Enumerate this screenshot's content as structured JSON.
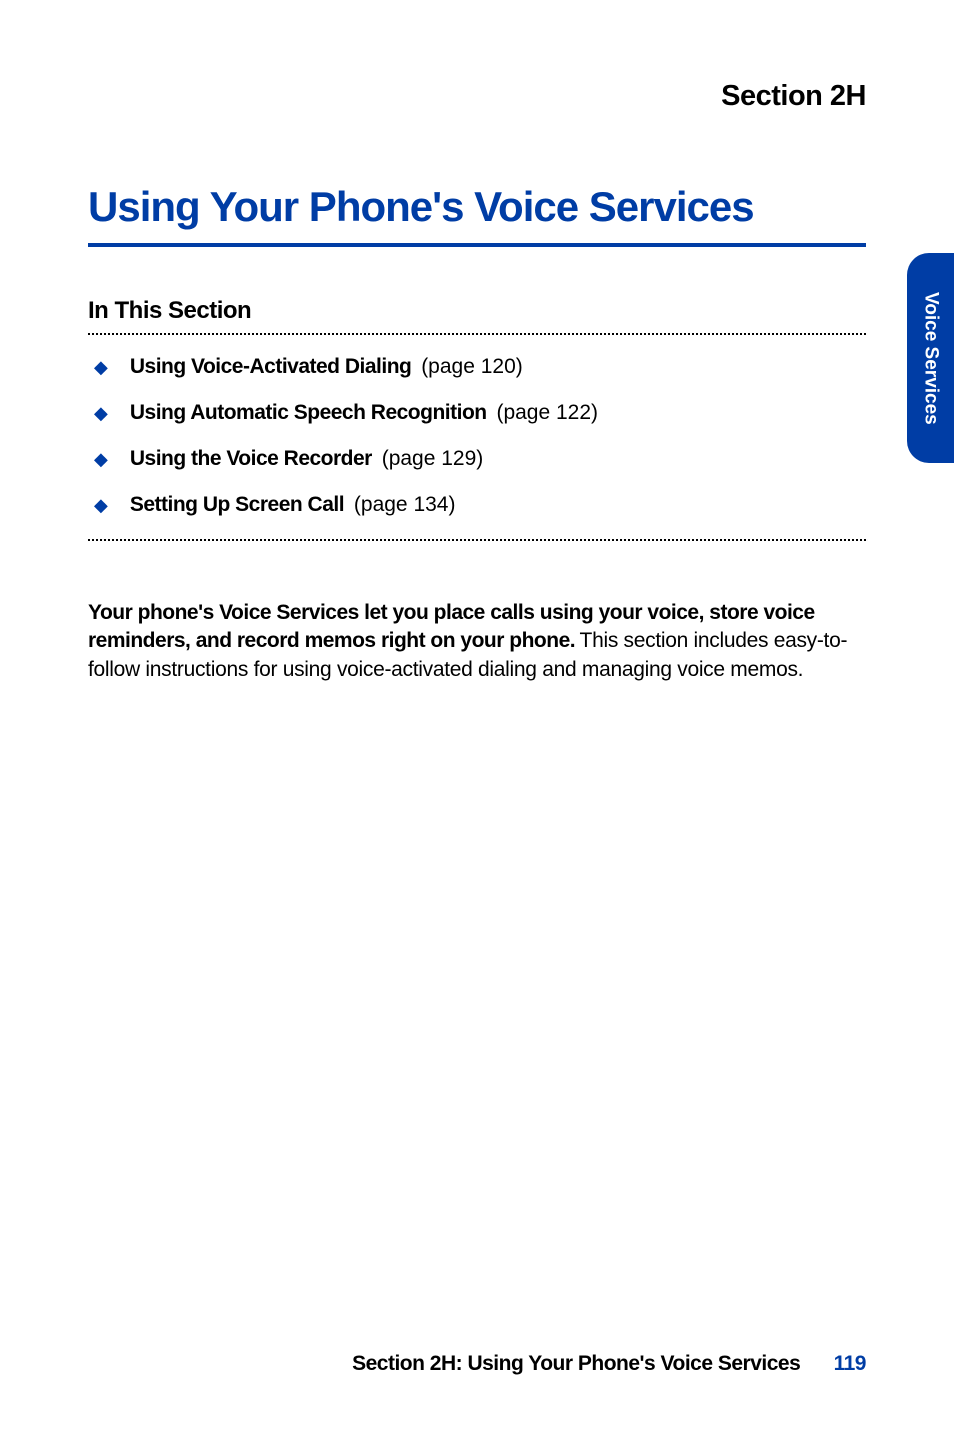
{
  "section_label": "Section 2H",
  "main_title": "Using Your Phone's Voice Services",
  "in_this_section_label": "In This Section",
  "toc": [
    {
      "title": "Using Voice-Activated Dialing",
      "page": "(page 120)"
    },
    {
      "title": "Using Automatic Speech Recognition",
      "page": "(page 122)"
    },
    {
      "title": "Using the Voice Recorder",
      "page": "(page 129)"
    },
    {
      "title": "Setting Up Screen Call",
      "page": "(page 134)"
    }
  ],
  "intro_bold": "Your phone's Voice Services let you place calls using your voice, store voice reminders, and record memos right on your phone.",
  "intro_body": "This section includes easy-to-follow instructions for using voice-activated dialing and managing voice memos.",
  "side_tab": "Voice Services",
  "footer_text": "Section 2H: Using Your Phone's Voice Services",
  "footer_page": "119"
}
